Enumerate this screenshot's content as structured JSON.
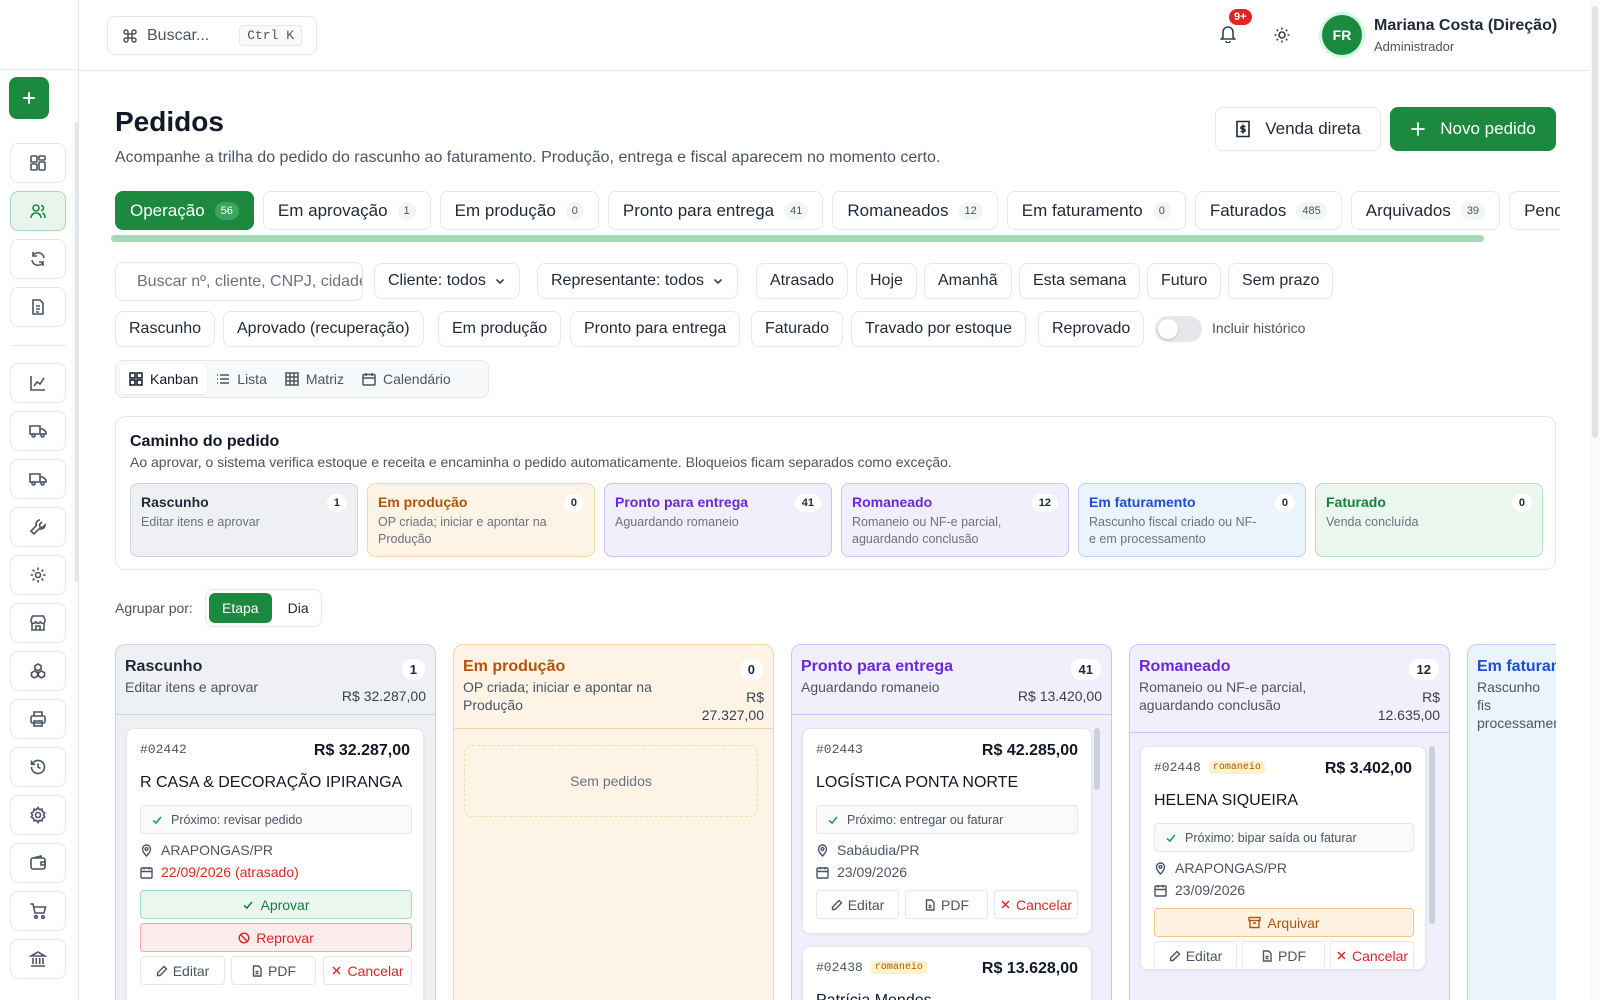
{
  "topbar": {
    "search_placeholder": "Buscar...",
    "search_shortcut": "Ctrl K",
    "notifications_badge": "9+",
    "user_initials": "FR",
    "user_name": "Mariana Costa (Direção)",
    "user_role": "Administrador"
  },
  "page": {
    "title": "Pedidos",
    "subtitle": "Acompanhe a trilha do pedido do rascunho ao faturamento. Produção, entrega e fiscal aparecem no momento certo.",
    "btn_venda": "Venda direta",
    "btn_novo": "Novo pedido"
  },
  "tabs": [
    {
      "label": "Operação",
      "count": "56"
    },
    {
      "label": "Em aprovação",
      "count": "1"
    },
    {
      "label": "Em produção",
      "count": "0"
    },
    {
      "label": "Pronto para entrega",
      "count": "41"
    },
    {
      "label": "Romaneados",
      "count": "12"
    },
    {
      "label": "Em faturamento",
      "count": "0"
    },
    {
      "label": "Faturados",
      "count": "485"
    },
    {
      "label": "Arquivados",
      "count": "39"
    },
    {
      "label": "Pendên",
      "count": ""
    }
  ],
  "filters": {
    "search_placeholder": "Buscar nº, cliente, CNPJ, cidade...",
    "cliente": "Cliente: todos",
    "representante": "Representante: todos",
    "date_chips": [
      "Atrasado",
      "Hoje",
      "Amanhã",
      "Esta semana",
      "Futuro",
      "Sem prazo"
    ],
    "status_chips": [
      "Rascunho",
      "Aprovado (recuperação)",
      "Em produção",
      "Pronto para entrega",
      "Faturado",
      "Travado por estoque",
      "Reprovado"
    ],
    "incluir_historico": "Incluir histórico",
    "incluir_historico_on": false
  },
  "views": [
    "Kanban",
    "Lista",
    "Matriz",
    "Calendário"
  ],
  "path": {
    "title": "Caminho do pedido",
    "subtitle": "Ao aprovar, o sistema verifica estoque e receita e encaminha o pedido automaticamente. Bloqueios ficam separados como exceção.",
    "stages": [
      {
        "name": "Rascunho",
        "desc": "Editar itens e aprovar",
        "count": "1"
      },
      {
        "name": "Em produção",
        "desc": "OP criada; iniciar e apontar na Produção",
        "count": "0"
      },
      {
        "name": "Pronto para entrega",
        "desc": "Aguardando romaneio",
        "count": "41"
      },
      {
        "name": "Romaneado",
        "desc": "Romaneio ou NF-e parcial, aguardando conclusão",
        "count": "12"
      },
      {
        "name": "Em faturamento",
        "desc": "Rascunho fiscal criado ou NF-e em processamento",
        "count": "0"
      },
      {
        "name": "Faturado",
        "desc": "Venda concluída",
        "count": "0"
      }
    ]
  },
  "group": {
    "label": "Agrupar por:",
    "options": [
      "Etapa",
      "Dia"
    ]
  },
  "columns": [
    {
      "name": "Rascunho",
      "desc": "Editar itens e aprovar",
      "count": "1",
      "total": "R$ 32.287,00"
    },
    {
      "name": "Em produção",
      "desc": "OP criada; iniciar e apontar na Produção",
      "count": "0",
      "total": "R$ 27.327,00",
      "empty": "Sem pedidos"
    },
    {
      "name": "Pronto para entrega",
      "desc": "Aguardando romaneio",
      "count": "41",
      "total": "R$ 13.420,00"
    },
    {
      "name": "Romaneado",
      "desc": "Romaneio ou NF-e parcial, aguardando conclusão",
      "count": "12",
      "total": "R$ 12.635,00"
    },
    {
      "name": "Em faturam",
      "desc": "Rascunho fis processamen",
      "count": "",
      "total": ""
    }
  ],
  "cards": {
    "c1": {
      "id": "#02442",
      "value": "R$ 32.287,00",
      "client": "R CASA & DECORAÇÃO IPIRANGA",
      "next": "Próximo: revisar pedido",
      "city": "ARAPONGAS/PR",
      "date": "22/09/2026 (atrasado)",
      "approve": "Aprovar",
      "reject": "Reprovar",
      "edit": "Editar",
      "pdf": "PDF",
      "cancel": "Cancelar"
    },
    "c2": {
      "id": "#02443",
      "value": "R$ 42.285,00",
      "client": "LOGÍSTICA PONTA NORTE",
      "next": "Próximo: entregar ou faturar",
      "city": "Sabáudia/PR",
      "date": "23/09/2026",
      "edit": "Editar",
      "pdf": "PDF",
      "cancel": "Cancelar"
    },
    "c3": {
      "id": "#02438",
      "tag": "romaneio",
      "value": "R$ 13.628,00",
      "client": "Patrícia Mendes"
    },
    "c4": {
      "id": "#02448",
      "tag": "romaneio",
      "value": "R$ 3.402,00",
      "client": "HELENA SIQUEIRA",
      "next": "Próximo: bipar saída ou faturar",
      "city": "ARAPONGAS/PR",
      "date": "23/09/2026",
      "archive": "Arquivar",
      "edit": "Editar",
      "pdf": "PDF",
      "cancel": "Cancelar"
    }
  }
}
